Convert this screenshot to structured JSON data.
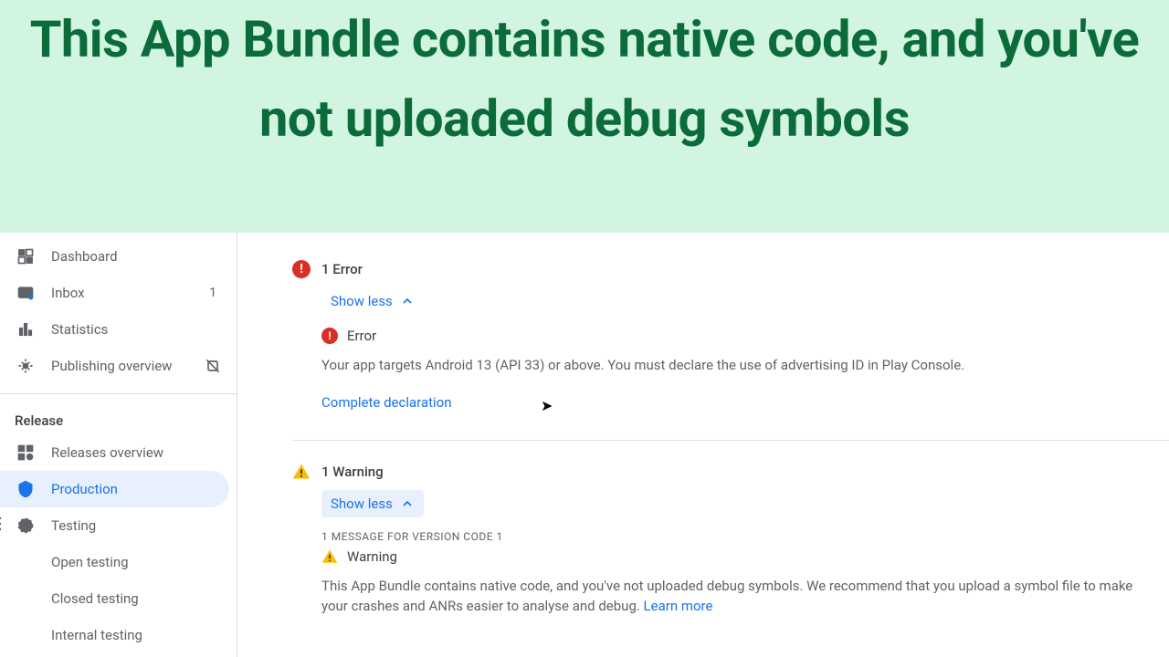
{
  "banner": {
    "title": "This App Bundle contains native code, and you've not uploaded debug symbols"
  },
  "sidebar": {
    "items": [
      {
        "label": "Dashboard"
      },
      {
        "label": "Inbox",
        "badge": "1"
      },
      {
        "label": "Statistics"
      },
      {
        "label": "Publishing overview"
      }
    ],
    "release_section": "Release",
    "release_items": [
      {
        "label": "Releases overview"
      },
      {
        "label": "Production"
      },
      {
        "label": "Testing"
      },
      {
        "label": "Open testing"
      },
      {
        "label": "Closed testing"
      },
      {
        "label": "Internal testing"
      }
    ]
  },
  "errors": {
    "count_label": "1 Error",
    "toggle": "Show less",
    "item_label": "Error",
    "message": "Your app targets Android 13 (API 33) or above. You must declare the use of advertising ID in Play Console.",
    "action": "Complete declaration"
  },
  "warnings": {
    "count_label": "1 Warning",
    "toggle": "Show less",
    "version_caption": "1 MESSAGE FOR VERSION CODE 1",
    "item_label": "Warning",
    "message": "This App Bundle contains native code, and you've not uploaded debug symbols. We recommend that you upload a symbol file to make your crashes and ANRs easier to analyse and debug. ",
    "learn_more": "Learn more"
  }
}
